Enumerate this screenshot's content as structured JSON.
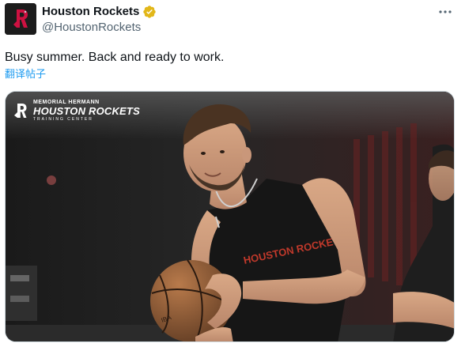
{
  "author": {
    "display_name": "Houston Rockets",
    "handle": "@HoustonRockets",
    "verified_icon": "verified-badge-icon",
    "avatar_icon": "rockets-logo-icon"
  },
  "post": {
    "text": "Busy summer. Back and ready to work.",
    "translate_label": "翻译帖子"
  },
  "media": {
    "watermark": {
      "top": "MEMORIAL HERMANN",
      "main": "HOUSTON ROCKETS",
      "sub": "TRAINING CENTER"
    },
    "jersey_text": "HOUSTON ROCKETS"
  },
  "menu": {
    "icon": "more-options-icon"
  },
  "colors": {
    "accent": "#1d9bf0",
    "text": "#0f1419",
    "secondary": "#536471",
    "verified_gold": "#e2b719",
    "rockets_red": "#ce1141"
  }
}
